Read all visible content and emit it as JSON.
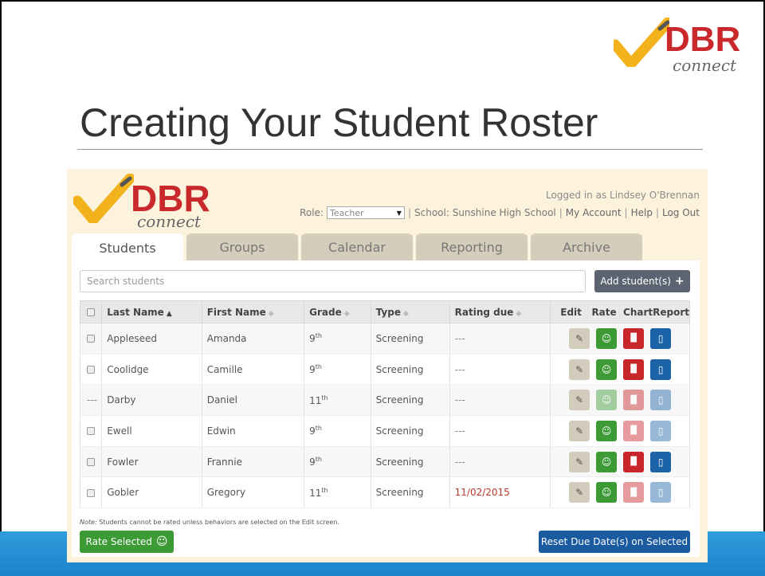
{
  "slide": {
    "title": "Creating Your Student Roster",
    "logo": {
      "word": "DBR",
      "sub": "connect"
    }
  },
  "app": {
    "logo": {
      "word": "DBR",
      "sub": "connect"
    },
    "logged_in": "Logged in as Lindsey O'Brennan",
    "role_label": "Role:",
    "role_value": "Teacher",
    "school": "School: Sunshine High School",
    "my_account": "My Account",
    "help": "Help",
    "logout": "Log Out",
    "tabs": [
      "Students",
      "Groups",
      "Calendar",
      "Reporting",
      "Archive"
    ],
    "search_placeholder": "Search students",
    "add_button": "Add student(s)",
    "columns": [
      "Last Name",
      "First Name",
      "Grade",
      "Type",
      "Rating due",
      "Edit",
      "Rate",
      "Chart",
      "Report"
    ],
    "rows": [
      {
        "checkbox": true,
        "last": "Appleseed",
        "first": "Amanda",
        "grade": "9",
        "grade_sup": "th",
        "type": "Screening",
        "due": "---",
        "due_red": false,
        "rate_enabled": true,
        "chart_enabled": true,
        "report_enabled": true
      },
      {
        "checkbox": true,
        "last": "Coolidge",
        "first": "Camille",
        "grade": "9",
        "grade_sup": "th",
        "type": "Screening",
        "due": "---",
        "due_red": false,
        "rate_enabled": true,
        "chart_enabled": true,
        "report_enabled": true
      },
      {
        "checkbox": false,
        "last": "Darby",
        "first": "Daniel",
        "grade": "11",
        "grade_sup": "th",
        "type": "Screening",
        "due": "---",
        "due_red": false,
        "rate_enabled": false,
        "chart_enabled": false,
        "report_enabled": false
      },
      {
        "checkbox": true,
        "last": "Ewell",
        "first": "Edwin",
        "grade": "9",
        "grade_sup": "th",
        "type": "Screening",
        "due": "---",
        "due_red": false,
        "rate_enabled": true,
        "chart_enabled": false,
        "report_enabled": false
      },
      {
        "checkbox": true,
        "last": "Fowler",
        "first": "Frannie",
        "grade": "9",
        "grade_sup": "th",
        "type": "Screening",
        "due": "---",
        "due_red": false,
        "rate_enabled": true,
        "chart_enabled": true,
        "report_enabled": true
      },
      {
        "checkbox": true,
        "last": "Gobler",
        "first": "Gregory",
        "grade": "11",
        "grade_sup": "th",
        "type": "Screening",
        "due": "11/02/2015",
        "due_red": true,
        "rate_enabled": true,
        "chart_enabled": false,
        "report_enabled": false
      }
    ],
    "note_label": "Note:",
    "note": "Students cannot be rated unless behaviors are selected on the Edit screen.",
    "rate_selected": "Rate Selected",
    "reset_due": "Reset Due Date(s) on Selected",
    "colors": {
      "rate": "#3c9b35",
      "chart": "#c8262b",
      "report": "#1c63a8",
      "edit": "#d3cbbb",
      "brand_red": "#c9282d",
      "band_blue": "#1a83c9"
    },
    "icons": {
      "edit": "pencil-icon",
      "rate": "smiley-icon",
      "chart": "bar-chart-icon",
      "report": "document-icon",
      "add": "plus-icon",
      "sort": "sort-icon"
    }
  }
}
